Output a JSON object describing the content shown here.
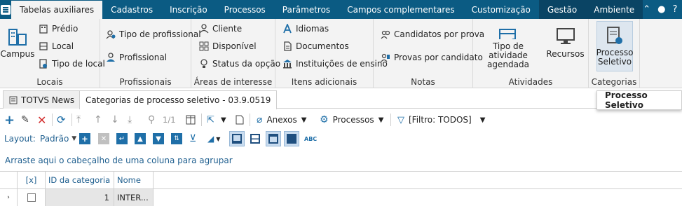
{
  "menu_tabs": [
    "Tabelas auxiliares",
    "Cadastros",
    "Inscrição",
    "Processos",
    "Parâmetros",
    "Campos complementares",
    "Customização",
    "Gestão",
    "Ambiente"
  ],
  "ribbon": {
    "locais": {
      "label": "Locais",
      "campus": "Campus",
      "predio": "Prédio",
      "local": "Local",
      "tipo_local": "Tipo de local"
    },
    "profissionais": {
      "label": "Profissionais",
      "tipo": "Tipo de profissional",
      "prof": "Profissional"
    },
    "areas": {
      "label": "Áreas de interesse",
      "cliente": "Cliente",
      "disponivel": "Disponível",
      "status": "Status da opção"
    },
    "itens": {
      "label": "Itens adicionais",
      "idiomas": "Idiomas",
      "documentos": "Documentos",
      "instituicoes": "Instituições de ensino"
    },
    "notas": {
      "label": "Notas",
      "candidatos": "Candidatos por prova",
      "provas": "Provas por candidato"
    },
    "atividades": {
      "label": "Atividades",
      "tipo_atividade_1": "Tipo de atividade",
      "tipo_atividade_2": "agendada",
      "recursos": "Recursos"
    },
    "categorias": {
      "label": "Categorias",
      "processo_1": "Processo",
      "processo_2": "Seletivo"
    }
  },
  "doc_tabs": {
    "news": "TOTVS News",
    "active": "Categorias de processo seletivo - 03.9.0519"
  },
  "tooltip": "Processo Seletivo",
  "toolbar": {
    "page": "1/1",
    "anexos": "Anexos",
    "processos": "Processos",
    "filtro": "[Filtro: TODOS]"
  },
  "layout": {
    "label": "Layout:",
    "value": "Padrão"
  },
  "group_hint": "Arraste aqui o cabeçalho de uma coluna para agrupar",
  "grid": {
    "headers": {
      "check": "[x]",
      "id": "ID da categoria",
      "nome": "Nome"
    },
    "rows": [
      {
        "id": "1",
        "nome": "INTER..."
      }
    ]
  }
}
